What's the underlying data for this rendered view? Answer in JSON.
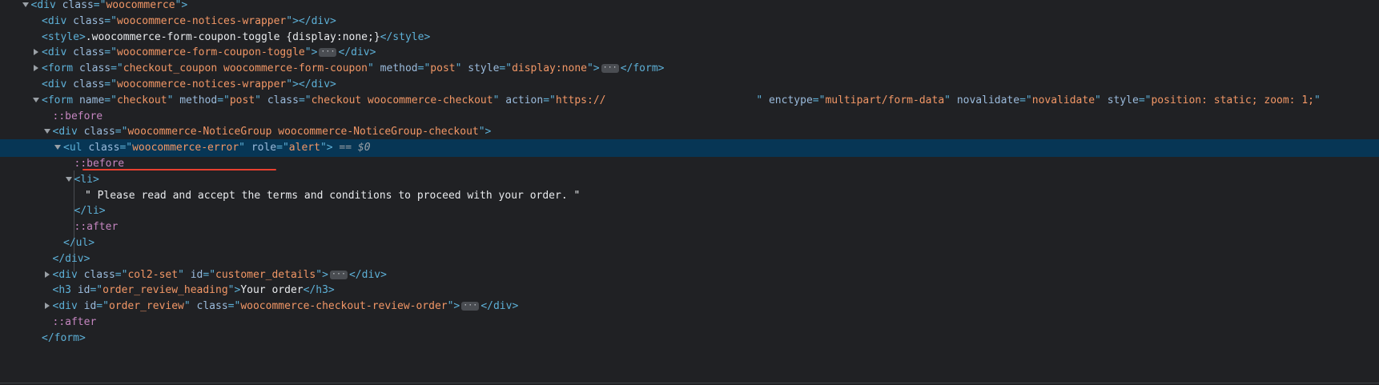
{
  "lines": [
    {
      "indent": 1,
      "toggle": "expanded",
      "selected": false,
      "segs": [
        {
          "c": "tag",
          "t": "<div "
        },
        {
          "c": "attr",
          "t": "class"
        },
        {
          "c": "tag",
          "t": "=\""
        },
        {
          "c": "val",
          "t": "woocommerce"
        },
        {
          "c": "tag",
          "t": "\">"
        }
      ]
    },
    {
      "indent": 2,
      "toggle": null,
      "selected": false,
      "segs": [
        {
          "c": "tag",
          "t": "<div "
        },
        {
          "c": "attr",
          "t": "class"
        },
        {
          "c": "tag",
          "t": "=\""
        },
        {
          "c": "val",
          "t": "woocommerce-notices-wrapper"
        },
        {
          "c": "tag",
          "t": "\"></div>"
        }
      ]
    },
    {
      "indent": 2,
      "toggle": null,
      "selected": false,
      "segs": [
        {
          "c": "tag",
          "t": "<style>"
        },
        {
          "c": "txt",
          "t": ".woocommerce-form-coupon-toggle {display:none;}"
        },
        {
          "c": "tag",
          "t": "</style>"
        }
      ]
    },
    {
      "indent": 2,
      "toggle": "collapsed",
      "selected": false,
      "segs": [
        {
          "c": "tag",
          "t": "<div "
        },
        {
          "c": "attr",
          "t": "class"
        },
        {
          "c": "tag",
          "t": "=\""
        },
        {
          "c": "val",
          "t": "woocommerce-form-coupon-toggle"
        },
        {
          "c": "tag",
          "t": "\">"
        },
        {
          "c": "ellipsis",
          "t": "···"
        },
        {
          "c": "tag",
          "t": "</div>"
        }
      ]
    },
    {
      "indent": 2,
      "toggle": "collapsed",
      "selected": false,
      "segs": [
        {
          "c": "tag",
          "t": "<form "
        },
        {
          "c": "attr",
          "t": "class"
        },
        {
          "c": "tag",
          "t": "=\""
        },
        {
          "c": "val",
          "t": "checkout_coupon woocommerce-form-coupon"
        },
        {
          "c": "tag",
          "t": "\" "
        },
        {
          "c": "attr",
          "t": "method"
        },
        {
          "c": "tag",
          "t": "=\""
        },
        {
          "c": "val",
          "t": "post"
        },
        {
          "c": "tag",
          "t": "\" "
        },
        {
          "c": "attr",
          "t": "style"
        },
        {
          "c": "tag",
          "t": "=\""
        },
        {
          "c": "val",
          "t": "display:none"
        },
        {
          "c": "tag",
          "t": "\">"
        },
        {
          "c": "ellipsis",
          "t": "···"
        },
        {
          "c": "tag",
          "t": "</form>"
        }
      ]
    },
    {
      "indent": 2,
      "toggle": null,
      "selected": false,
      "segs": [
        {
          "c": "tag",
          "t": "<div "
        },
        {
          "c": "attr",
          "t": "class"
        },
        {
          "c": "tag",
          "t": "=\""
        },
        {
          "c": "val",
          "t": "woocommerce-notices-wrapper"
        },
        {
          "c": "tag",
          "t": "\"></div>"
        }
      ]
    },
    {
      "indent": 2,
      "toggle": "expanded",
      "selected": false,
      "segs": [
        {
          "c": "tag",
          "t": "<form "
        },
        {
          "c": "attr",
          "t": "name"
        },
        {
          "c": "tag",
          "t": "=\""
        },
        {
          "c": "val",
          "t": "checkout"
        },
        {
          "c": "tag",
          "t": "\" "
        },
        {
          "c": "attr",
          "t": "method"
        },
        {
          "c": "tag",
          "t": "=\""
        },
        {
          "c": "val",
          "t": "post"
        },
        {
          "c": "tag",
          "t": "\" "
        },
        {
          "c": "attr",
          "t": "class"
        },
        {
          "c": "tag",
          "t": "=\""
        },
        {
          "c": "val",
          "t": "checkout woocommerce-checkout"
        },
        {
          "c": "tag",
          "t": "\" "
        },
        {
          "c": "attr",
          "t": "action"
        },
        {
          "c": "tag",
          "t": "=\""
        },
        {
          "c": "val",
          "t": "https://                        "
        },
        {
          "c": "tag",
          "t": "\" "
        },
        {
          "c": "attr",
          "t": "enctype"
        },
        {
          "c": "tag",
          "t": "=\""
        },
        {
          "c": "val",
          "t": "multipart/form-data"
        },
        {
          "c": "tag",
          "t": "\" "
        },
        {
          "c": "attr",
          "t": "novalidate"
        },
        {
          "c": "tag",
          "t": "=\""
        },
        {
          "c": "val",
          "t": "novalidate"
        },
        {
          "c": "tag",
          "t": "\" "
        },
        {
          "c": "attr",
          "t": "style"
        },
        {
          "c": "tag",
          "t": "=\""
        },
        {
          "c": "val",
          "t": "position: static; zoom: 1;"
        },
        {
          "c": "tag",
          "t": "\""
        }
      ]
    },
    {
      "indent": 3,
      "toggle": null,
      "selected": false,
      "segs": [
        {
          "c": "pseudo",
          "t": "::before"
        }
      ]
    },
    {
      "indent": 3,
      "toggle": "expanded",
      "selected": false,
      "segs": [
        {
          "c": "tag",
          "t": "<div "
        },
        {
          "c": "attr",
          "t": "class"
        },
        {
          "c": "tag",
          "t": "=\""
        },
        {
          "c": "val",
          "t": "woocommerce-NoticeGroup woocommerce-NoticeGroup-checkout"
        },
        {
          "c": "tag",
          "t": "\">"
        }
      ]
    },
    {
      "indent": 4,
      "toggle": "expanded",
      "selected": true,
      "segs": [
        {
          "c": "tag",
          "t": "<ul "
        },
        {
          "c": "attr",
          "t": "class"
        },
        {
          "c": "tag",
          "t": "=\""
        },
        {
          "c": "val",
          "t": "woocommerce-error"
        },
        {
          "c": "tag",
          "t": "\" "
        },
        {
          "c": "attr",
          "t": "role"
        },
        {
          "c": "tag",
          "t": "=\""
        },
        {
          "c": "val",
          "t": "alert"
        },
        {
          "c": "tag",
          "t": "\">"
        },
        {
          "c": "marker",
          "t": " == "
        },
        {
          "c": "dollar",
          "t": "$0"
        }
      ]
    },
    {
      "indent": 5,
      "toggle": null,
      "selected": false,
      "segs": [
        {
          "c": "pseudo",
          "t": "::before"
        }
      ]
    },
    {
      "indent": 5,
      "toggle": "expanded",
      "selected": false,
      "segs": [
        {
          "c": "tag",
          "t": "<li>"
        }
      ]
    },
    {
      "indent": 6,
      "toggle": null,
      "selected": false,
      "segs": [
        {
          "c": "txt",
          "t": "\" Please read and accept the terms and conditions to proceed with your order. \""
        }
      ]
    },
    {
      "indent": 5,
      "toggle": null,
      "selected": false,
      "segs": [
        {
          "c": "tag",
          "t": "</li>"
        }
      ]
    },
    {
      "indent": 5,
      "toggle": null,
      "selected": false,
      "segs": [
        {
          "c": "pseudo",
          "t": "::after"
        }
      ]
    },
    {
      "indent": 4,
      "toggle": null,
      "selected": false,
      "segs": [
        {
          "c": "tag",
          "t": "</ul>"
        }
      ]
    },
    {
      "indent": 3,
      "toggle": null,
      "selected": false,
      "segs": [
        {
          "c": "tag",
          "t": "</div>"
        }
      ]
    },
    {
      "indent": 3,
      "toggle": "collapsed",
      "selected": false,
      "segs": [
        {
          "c": "tag",
          "t": "<div "
        },
        {
          "c": "attr",
          "t": "class"
        },
        {
          "c": "tag",
          "t": "=\""
        },
        {
          "c": "val",
          "t": "col2-set"
        },
        {
          "c": "tag",
          "t": "\" "
        },
        {
          "c": "attr",
          "t": "id"
        },
        {
          "c": "tag",
          "t": "=\""
        },
        {
          "c": "val",
          "t": "customer_details"
        },
        {
          "c": "tag",
          "t": "\">"
        },
        {
          "c": "ellipsis",
          "t": "···"
        },
        {
          "c": "tag",
          "t": "</div>"
        }
      ]
    },
    {
      "indent": 3,
      "toggle": null,
      "selected": false,
      "segs": [
        {
          "c": "tag",
          "t": "<h3 "
        },
        {
          "c": "attr",
          "t": "id"
        },
        {
          "c": "tag",
          "t": "=\""
        },
        {
          "c": "val",
          "t": "order_review_heading"
        },
        {
          "c": "tag",
          "t": "\">"
        },
        {
          "c": "txt",
          "t": "Your order"
        },
        {
          "c": "tag",
          "t": "</h3>"
        }
      ]
    },
    {
      "indent": 3,
      "toggle": "collapsed",
      "selected": false,
      "segs": [
        {
          "c": "tag",
          "t": "<div "
        },
        {
          "c": "attr",
          "t": "id"
        },
        {
          "c": "tag",
          "t": "=\""
        },
        {
          "c": "val",
          "t": "order_review"
        },
        {
          "c": "tag",
          "t": "\" "
        },
        {
          "c": "attr",
          "t": "class"
        },
        {
          "c": "tag",
          "t": "=\""
        },
        {
          "c": "val",
          "t": "woocommerce-checkout-review-order"
        },
        {
          "c": "tag",
          "t": "\">"
        },
        {
          "c": "ellipsis",
          "t": "···"
        },
        {
          "c": "tag",
          "t": "</div>"
        }
      ]
    },
    {
      "indent": 3,
      "toggle": null,
      "selected": false,
      "segs": [
        {
          "c": "pseudo",
          "t": "::after"
        }
      ]
    },
    {
      "indent": 2,
      "toggle": null,
      "selected": false,
      "segs": [
        {
          "c": "tag",
          "t": "</form>"
        }
      ]
    }
  ],
  "colors": {
    "background": "#202124",
    "selected_row": "#073655",
    "tag": "#5db0d7",
    "attribute": "#9bbbdc",
    "value": "#f29766",
    "pseudo": "#c586c0",
    "highlight_underline": "#e8402f"
  },
  "icons": {
    "expanded": "triangle-down-icon",
    "collapsed": "triangle-right-icon",
    "ellipsis": "ellipsis-badge-icon"
  }
}
